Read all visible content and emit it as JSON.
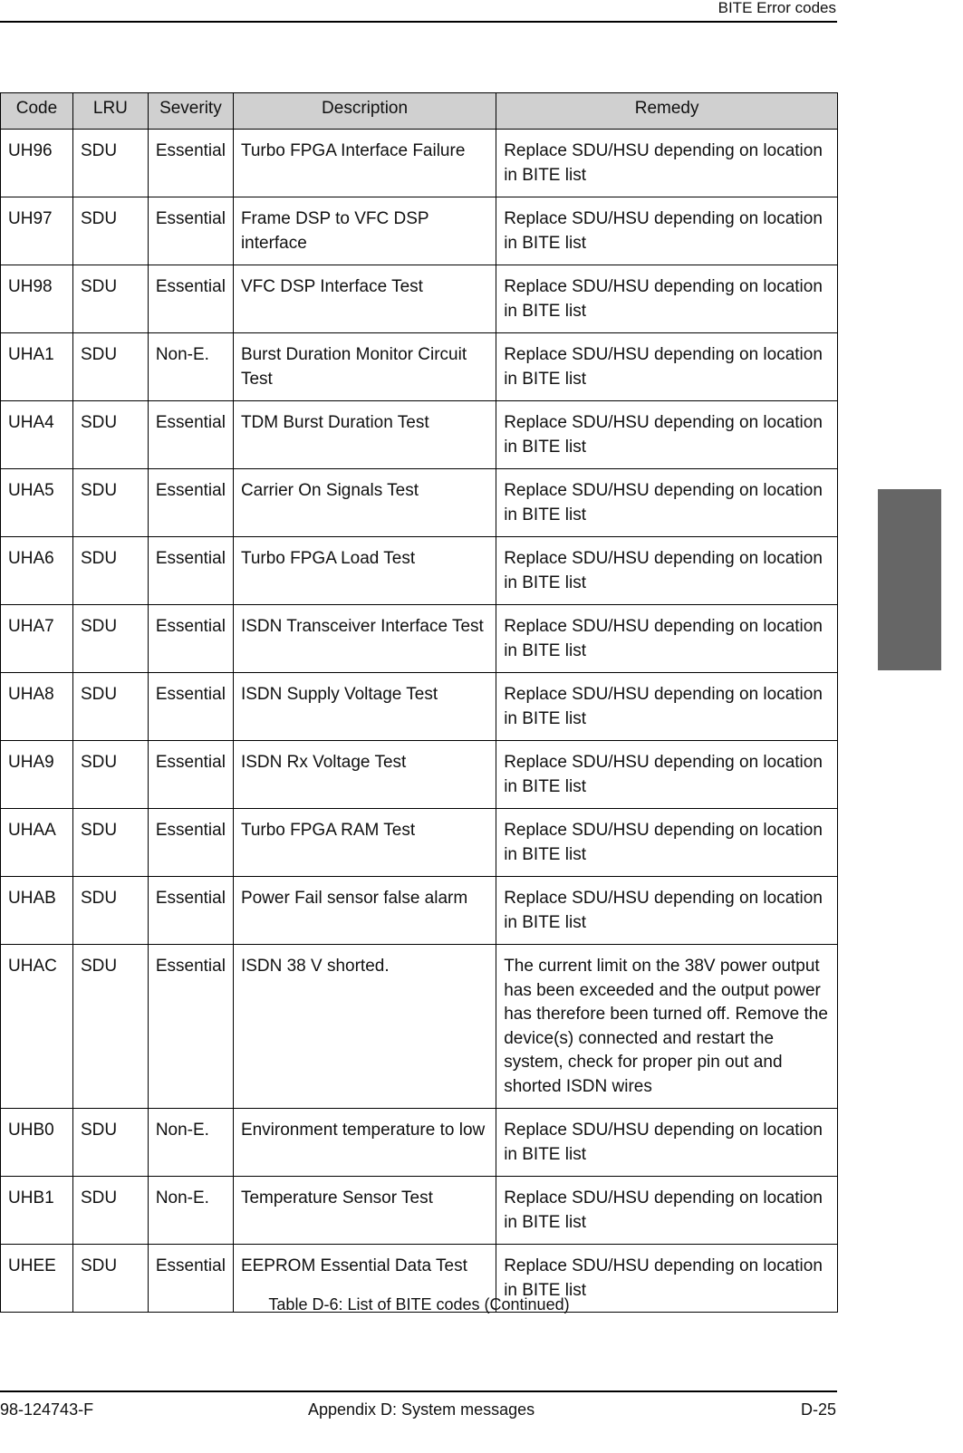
{
  "header": {
    "title": "BITE Error codes"
  },
  "table": {
    "columns": [
      "Code",
      "LRU",
      "Severity",
      "Description",
      "Remedy"
    ],
    "rows": [
      {
        "code": "UH96",
        "lru": "SDU",
        "severity": "Essential",
        "description": "Turbo FPGA Interface Failure",
        "remedy": "Replace SDU/HSU depending on location in BITE list"
      },
      {
        "code": "UH97",
        "lru": "SDU",
        "severity": "Essential",
        "description": "Frame DSP to VFC DSP interface",
        "remedy": "Replace SDU/HSU depending on location in BITE list"
      },
      {
        "code": "UH98",
        "lru": "SDU",
        "severity": "Essential",
        "description": "VFC DSP Interface Test",
        "remedy": "Replace SDU/HSU depending on location in BITE list"
      },
      {
        "code": "UHA1",
        "lru": "SDU",
        "severity": "Non-E.",
        "description": "Burst Duration Monitor Circuit Test",
        "remedy": "Replace SDU/HSU depending on location in BITE list"
      },
      {
        "code": "UHA4",
        "lru": "SDU",
        "severity": "Essential",
        "description": "TDM Burst Duration Test",
        "remedy": "Replace SDU/HSU depending on location in BITE list"
      },
      {
        "code": "UHA5",
        "lru": "SDU",
        "severity": "Essential",
        "description": "Carrier On Signals Test",
        "remedy": "Replace SDU/HSU depending on location in BITE list"
      },
      {
        "code": "UHA6",
        "lru": "SDU",
        "severity": "Essential",
        "description": "Turbo FPGA Load Test",
        "remedy": "Replace SDU/HSU depending on location in BITE list"
      },
      {
        "code": "UHA7",
        "lru": "SDU",
        "severity": "Essential",
        "description": "ISDN Transceiver Interface Test",
        "remedy": "Replace SDU/HSU depending on location in BITE list"
      },
      {
        "code": "UHA8",
        "lru": "SDU",
        "severity": "Essential",
        "description": "ISDN Supply Voltage Test",
        "remedy": "Replace SDU/HSU depending on location in BITE list"
      },
      {
        "code": "UHA9",
        "lru": "SDU",
        "severity": "Essential",
        "description": "ISDN Rx Voltage Test",
        "remedy": "Replace SDU/HSU depending on location in BITE list"
      },
      {
        "code": "UHAA",
        "lru": "SDU",
        "severity": "Essential",
        "description": "Turbo FPGA RAM Test",
        "remedy": "Replace SDU/HSU depending on location in BITE list"
      },
      {
        "code": "UHAB",
        "lru": "SDU",
        "severity": "Essential",
        "description": "Power Fail sensor false alarm",
        "remedy": "Replace SDU/HSU depending on location in BITE list"
      },
      {
        "code": "UHAC",
        "lru": "SDU",
        "severity": "Essential",
        "description": "ISDN 38 V shorted.",
        "remedy": "The current limit on the 38V power output has been exceeded and the output power has therefore been turned off. Remove the device(s) connected and restart the system, check for proper pin out and shorted ISDN wires"
      },
      {
        "code": "UHB0",
        "lru": "SDU",
        "severity": "Non-E.",
        "description": "Environment temperature to low",
        "remedy": "Replace SDU/HSU depending on location in BITE list"
      },
      {
        "code": "UHB1",
        "lru": "SDU",
        "severity": "Non-E.",
        "description": "Temperature Sensor Test",
        "remedy": "Replace SDU/HSU depending on location in BITE list"
      },
      {
        "code": "UHEE",
        "lru": "SDU",
        "severity": "Essential",
        "description": "EEPROM Essential Data Test",
        "remedy": "Replace SDU/HSU depending on location in BITE list"
      }
    ],
    "caption": "Table D-6: List of BITE codes (Continued)"
  },
  "colors": {
    "header_bg": "#d0d0d0",
    "side_tab": "#666666"
  },
  "footer": {
    "doc_number": "98-124743-F",
    "section": "Appendix D:  System messages",
    "page": "D-25"
  }
}
